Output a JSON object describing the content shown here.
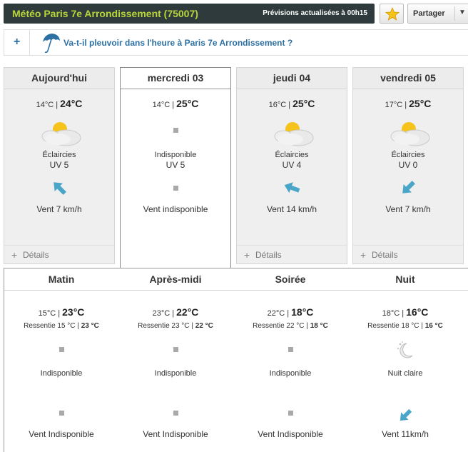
{
  "header": {
    "title": "Météo Paris 7e Arrondissement (75007)",
    "update": "Prévisions actualisées à 00h15",
    "share_label": "Partager",
    "star_icon": "star-icon",
    "caret_icon": "caret-down-icon"
  },
  "rain": {
    "plus": "+",
    "question": "Va-t-il pleuvoir dans l'heure à Paris 7e Arrondissement ?",
    "icon": "umbrella-icon"
  },
  "days": [
    {
      "name": "Aujourd'hui",
      "tmin": "14°C",
      "sep": "|",
      "tmax": "24°C",
      "icon": "sun-cloud-icon",
      "cond": "Éclaircies",
      "uv": "UV 5",
      "wind_icon": "wind-arrow-icon",
      "wind": "Vent 7 km/h",
      "details": "Détails"
    },
    {
      "name": "mercredi 03",
      "tmin": "14°C",
      "sep": "|",
      "tmax": "25°C",
      "icon": "unavailable-icon",
      "cond": "Indisponible",
      "uv": "UV 5",
      "wind_icon": "unavailable-icon",
      "wind": "Vent indisponible",
      "details": ""
    },
    {
      "name": "jeudi 04",
      "tmin": "16°C",
      "sep": "|",
      "tmax": "25°C",
      "icon": "sun-cloud-icon",
      "cond": "Éclaircies",
      "uv": "UV 4",
      "wind_icon": "wind-arrow-icon",
      "wind": "Vent 14 km/h",
      "details": "Détails"
    },
    {
      "name": "vendredi 05",
      "tmin": "17°C",
      "sep": "|",
      "tmax": "25°C",
      "icon": "sun-cloud-icon",
      "cond": "Éclaircies",
      "uv": "UV 0",
      "wind_icon": "wind-arrow-icon",
      "wind": "Vent 7 km/h",
      "details": "Détails"
    }
  ],
  "periods": [
    {
      "name": "Matin",
      "tmin": "15°C",
      "sep": "|",
      "tmax": "23°C",
      "feel": "Ressentie 15 °C",
      "feel_sep": "|",
      "feel_b": "23 °C",
      "icon": "unavailable-icon",
      "cond": "Indisponible",
      "wind_icon": "unavailable-icon",
      "wind": "Vent Indisponible"
    },
    {
      "name": "Après-midi",
      "tmin": "23°C",
      "sep": "|",
      "tmax": "22°C",
      "feel": "Ressentie 23 °C",
      "feel_sep": "|",
      "feel_b": "22 °C",
      "icon": "unavailable-icon",
      "cond": "Indisponible",
      "wind_icon": "unavailable-icon",
      "wind": "Vent Indisponible"
    },
    {
      "name": "Soirée",
      "tmin": "22°C",
      "sep": "|",
      "tmax": "18°C",
      "feel": "Ressentie 22 °C",
      "feel_sep": "|",
      "feel_b": "18 °C",
      "icon": "unavailable-icon",
      "cond": "Indisponible",
      "wind_icon": "unavailable-icon",
      "wind": "Vent Indisponible"
    },
    {
      "name": "Nuit",
      "tmin": "18°C",
      "sep": "|",
      "tmax": "16°C",
      "feel": "Ressentie 18 °C",
      "feel_sep": "|",
      "feel_b": "16 °C",
      "icon": "moon-stars-icon",
      "cond": "Nuit claire",
      "wind_icon": "wind-arrow-icon",
      "wind": "Vent 11km/h"
    }
  ],
  "colors": {
    "title_bg": "#2f3a3c",
    "title_text": "#b8d63a",
    "link_blue": "#2c6fa3",
    "wind_arrow": "#4aa6c8",
    "sun": "#f6c21c"
  }
}
